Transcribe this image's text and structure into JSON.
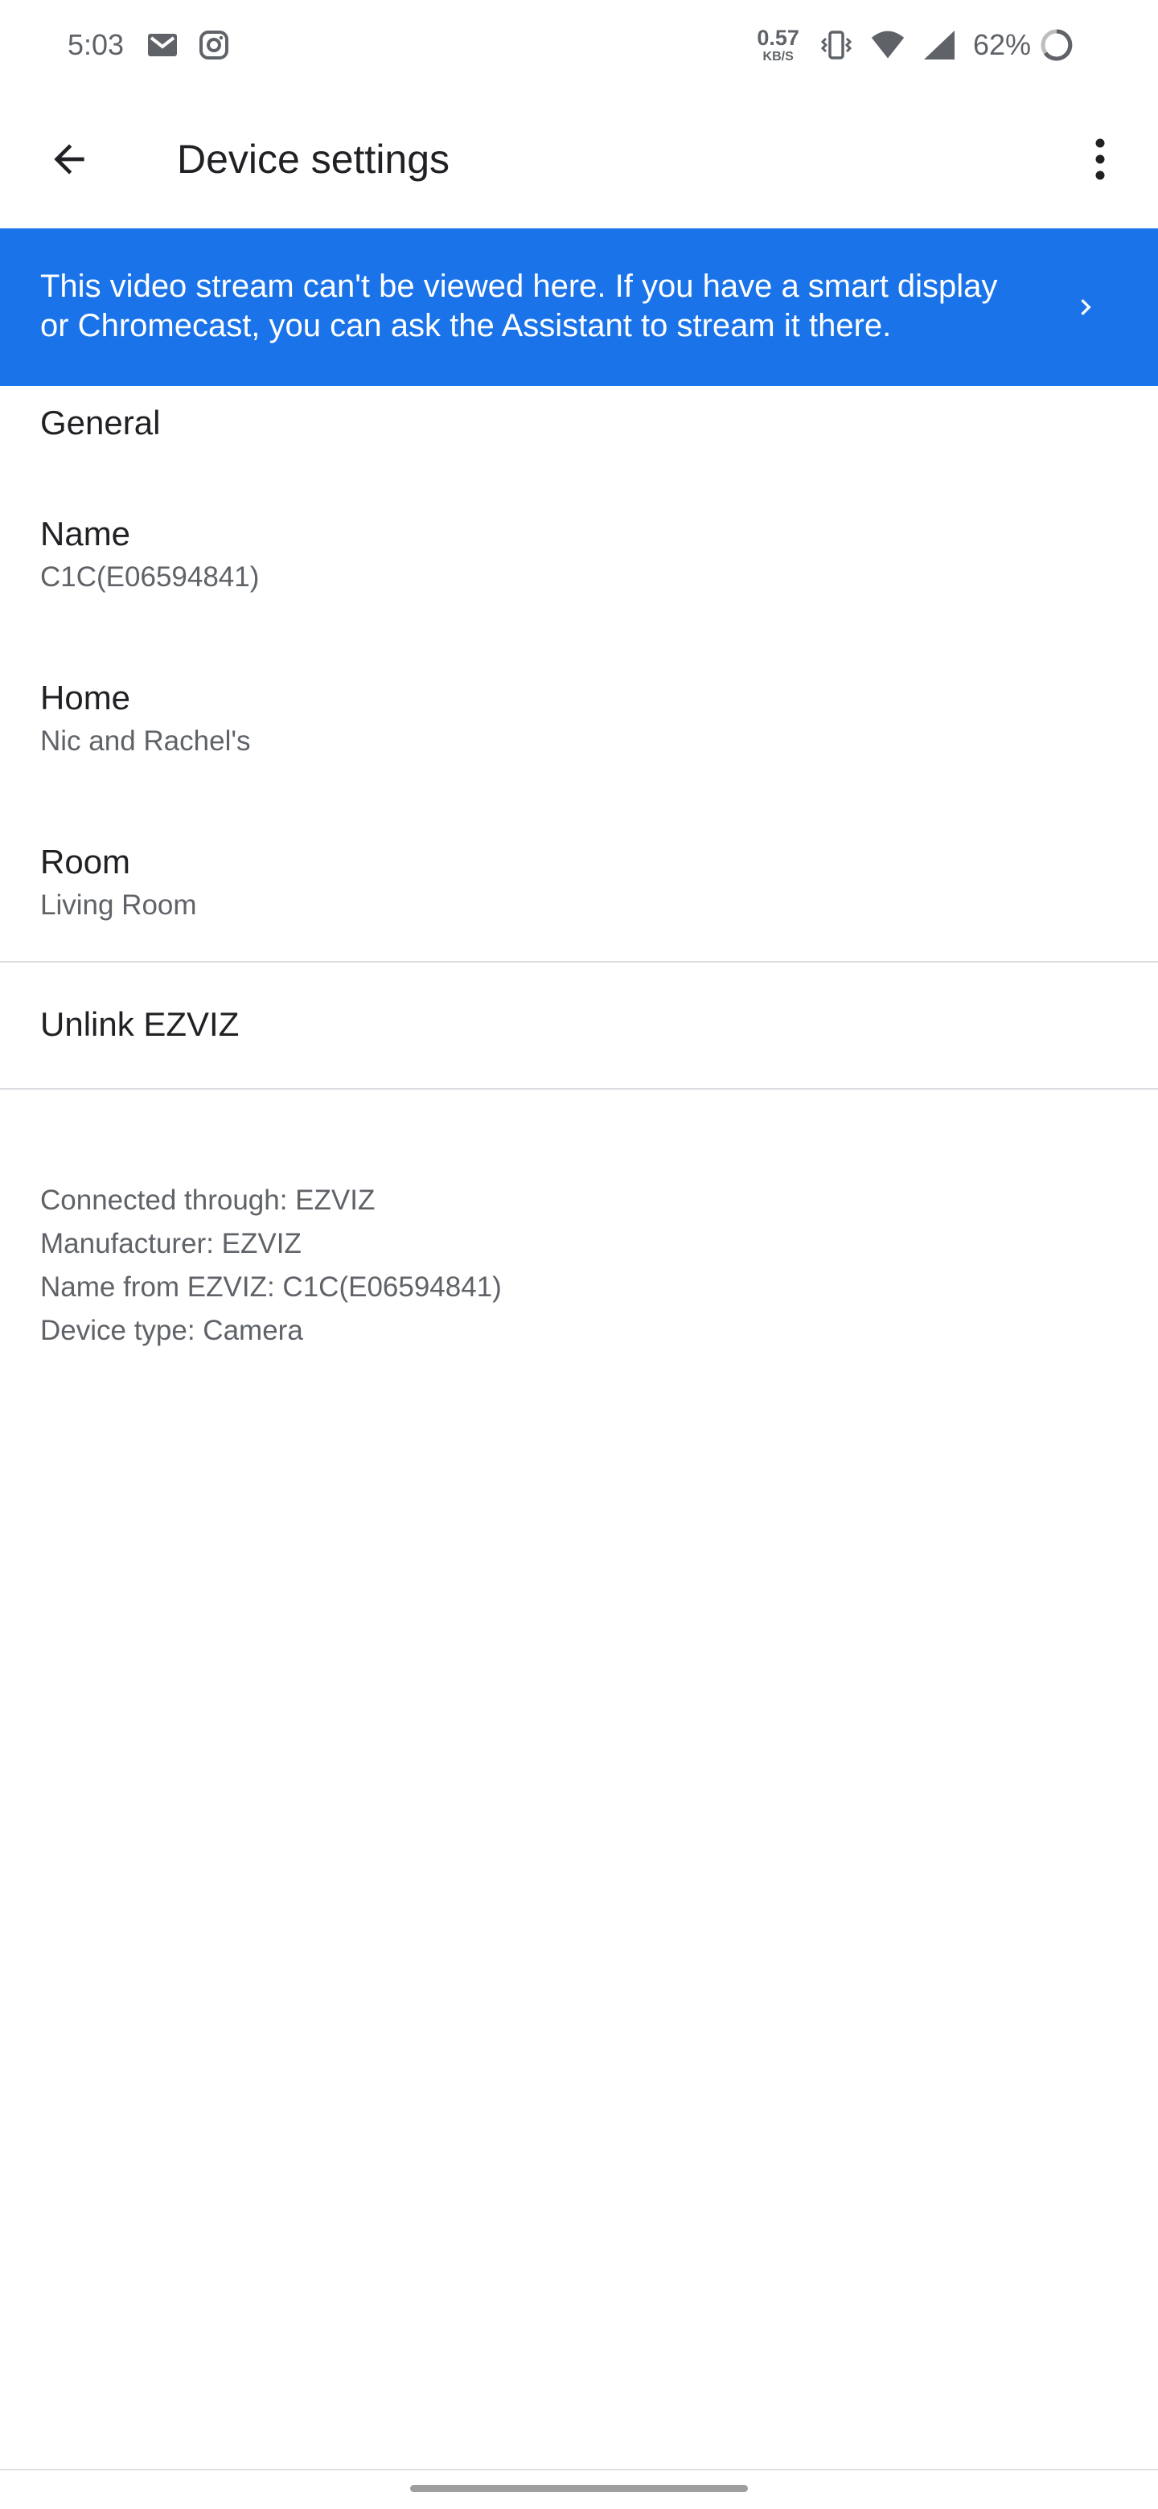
{
  "status_bar": {
    "time": "5:03",
    "net_speed_value": "0.57",
    "net_speed_unit": "KB/S",
    "battery_percent": "62%",
    "icons": [
      "gmail-icon",
      "instagram-icon",
      "vibrate-icon",
      "wifi-icon",
      "cellular-signal-icon",
      "battery-icon"
    ]
  },
  "app_bar": {
    "title": "Device settings",
    "back_icon": "arrow-back-icon",
    "more_icon": "more-vert-icon"
  },
  "banner": {
    "text": "This video stream can't be viewed here. If you have a smart display or Chromecast, you can ask the Assistant to stream it there.",
    "icon": "chevron-right-icon",
    "background_color": "#1a73e8"
  },
  "general": {
    "header": "General",
    "items": [
      {
        "title": "Name",
        "value": "C1C(E06594841)"
      },
      {
        "title": "Home",
        "value": "Nic and Rachel's"
      },
      {
        "title": "Room",
        "value": "Living Room"
      }
    ]
  },
  "unlink": {
    "label": "Unlink EZVIZ"
  },
  "device_info": {
    "lines": [
      "Connected through: EZVIZ",
      "Manufacturer: EZVIZ",
      "Name from EZVIZ: C1C(E06594841)",
      "Device type: Camera"
    ]
  }
}
